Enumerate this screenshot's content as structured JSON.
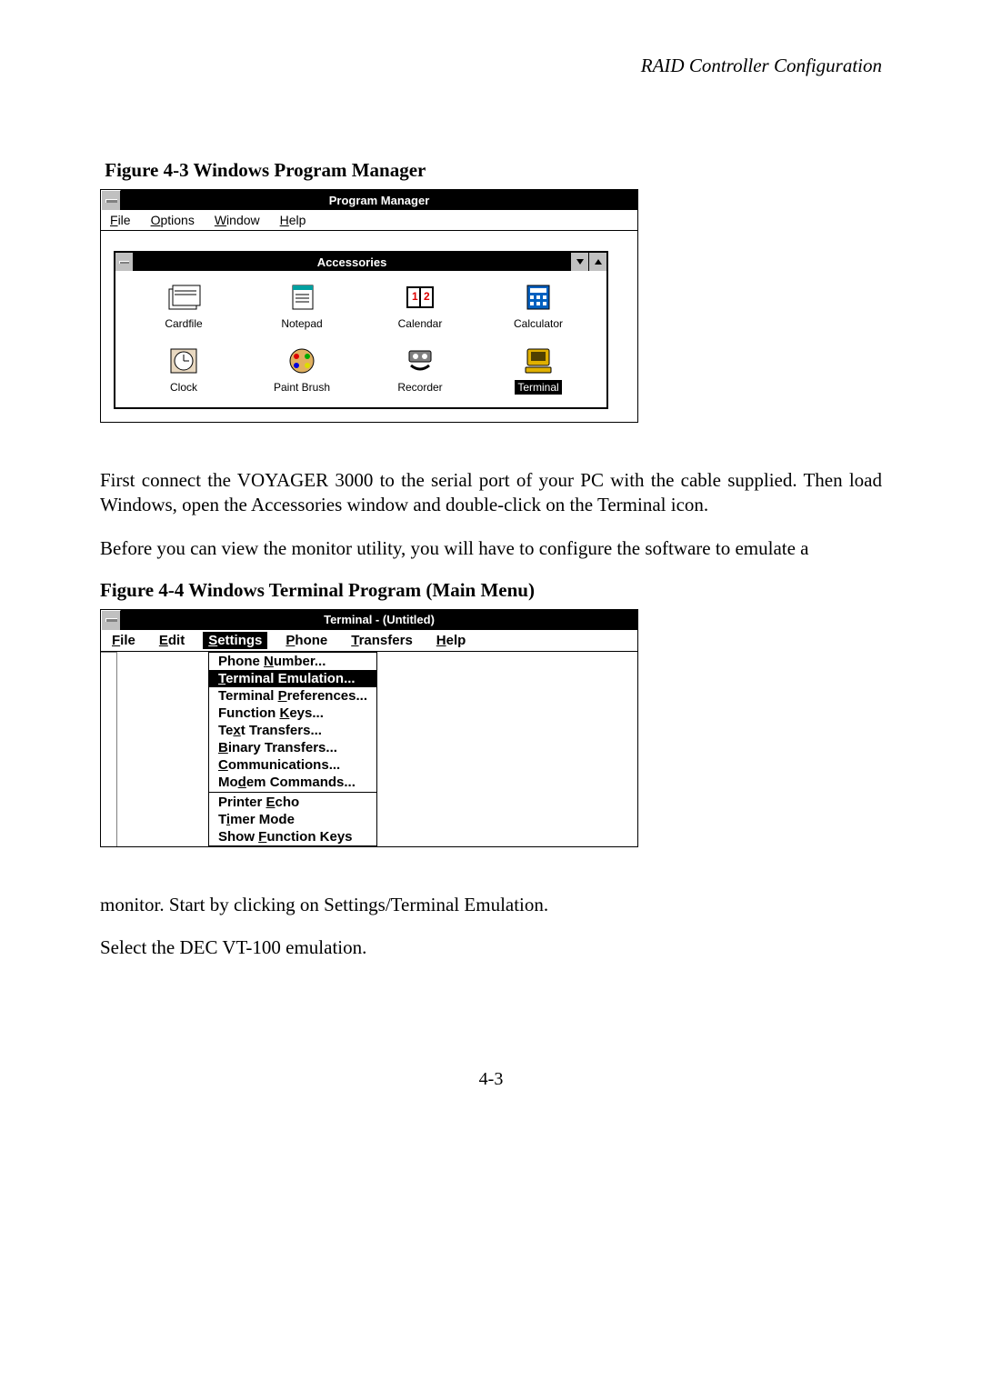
{
  "header": {
    "right": "RAID Controller Configuration"
  },
  "figure1": {
    "caption": "Figure 4-3 Windows Program Manager",
    "pm": {
      "title": "Program Manager",
      "menus": {
        "file": "File",
        "options": "Options",
        "window": "Window",
        "help": "Help"
      }
    },
    "accessories": {
      "title": "Accessories",
      "items": [
        {
          "label": "Cardfile"
        },
        {
          "label": "Notepad"
        },
        {
          "label": "Calendar"
        },
        {
          "label": "Calculator"
        },
        {
          "label": "Clock"
        },
        {
          "label": "Paint Brush"
        },
        {
          "label": "Recorder"
        },
        {
          "label": "Terminal",
          "selected": true
        }
      ]
    }
  },
  "para1": "First connect the VOYAGER 3000 to the serial port of your PC with the cable supplied. Then load Windows, open the Accessories window and double-click on the Terminal icon.",
  "para2": "Before you can view the monitor utility, you will have to configure the software to emulate a",
  "figure2": {
    "caption": "Figure 4-4 Windows Terminal Program (Main Menu)",
    "term": {
      "title": "Terminal - (Untitled)",
      "menus": {
        "file": "File",
        "edit": "Edit",
        "settings": "Settings",
        "phone": "Phone",
        "transfers": "Transfers",
        "help": "Help"
      },
      "dropdown": [
        {
          "label": "Phone Number..."
        },
        {
          "label": "Terminal Emulation...",
          "highlight": true
        },
        {
          "label": "Terminal Preferences..."
        },
        {
          "label": "Function Keys..."
        },
        {
          "label": "Text Transfers..."
        },
        {
          "label": "Binary Transfers..."
        },
        {
          "label": "Communications..."
        },
        {
          "label": "Modem Commands..."
        },
        {
          "sep": true
        },
        {
          "label": "Printer Echo"
        },
        {
          "label": "Timer Mode"
        },
        {
          "label": "Show Function Keys"
        }
      ]
    }
  },
  "para3": "monitor. Start by clicking on Settings/Terminal Emulation.",
  "para4": "Select the DEC VT-100  emulation.",
  "footer": "4-3"
}
